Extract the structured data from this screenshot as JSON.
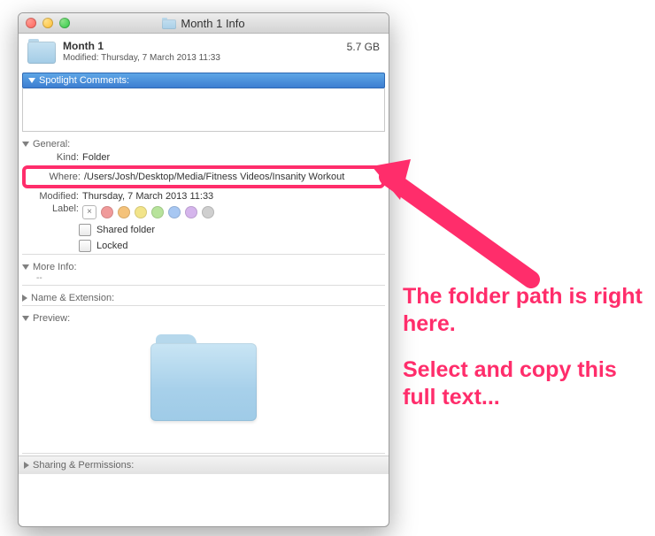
{
  "window": {
    "title": "Month 1 Info"
  },
  "header": {
    "name": "Month 1",
    "modified_line": "Modified: Thursday, 7 March 2013 11:33",
    "size": "5.7 GB"
  },
  "spotlight": {
    "label": "Spotlight Comments:"
  },
  "sections": {
    "general": "General:",
    "more_info": "More Info:",
    "name_ext": "Name & Extension:",
    "preview": "Preview:",
    "sharing": "Sharing & Permissions:"
  },
  "general": {
    "kind_label": "Kind:",
    "kind_value": "Folder",
    "where_label": "Where:",
    "where_value": "/Users/Josh/Desktop/Media/Fitness Videos/Insanity Workout",
    "modified_label": "Modified:",
    "modified_value": "Thursday, 7 March 2013 11:33",
    "label_label": "Label:",
    "shared_folder": "Shared folder",
    "locked": "Locked"
  },
  "more_info": {
    "placeholder": "--"
  },
  "label_colors": [
    "#f09a9a",
    "#f4c27a",
    "#f2e48a",
    "#b7e39b",
    "#a7c7f2",
    "#d5b5ec",
    "#cfcfcf"
  ],
  "annotation": {
    "line1": "The folder path is right here.",
    "line2": "Select and copy this full text..."
  }
}
